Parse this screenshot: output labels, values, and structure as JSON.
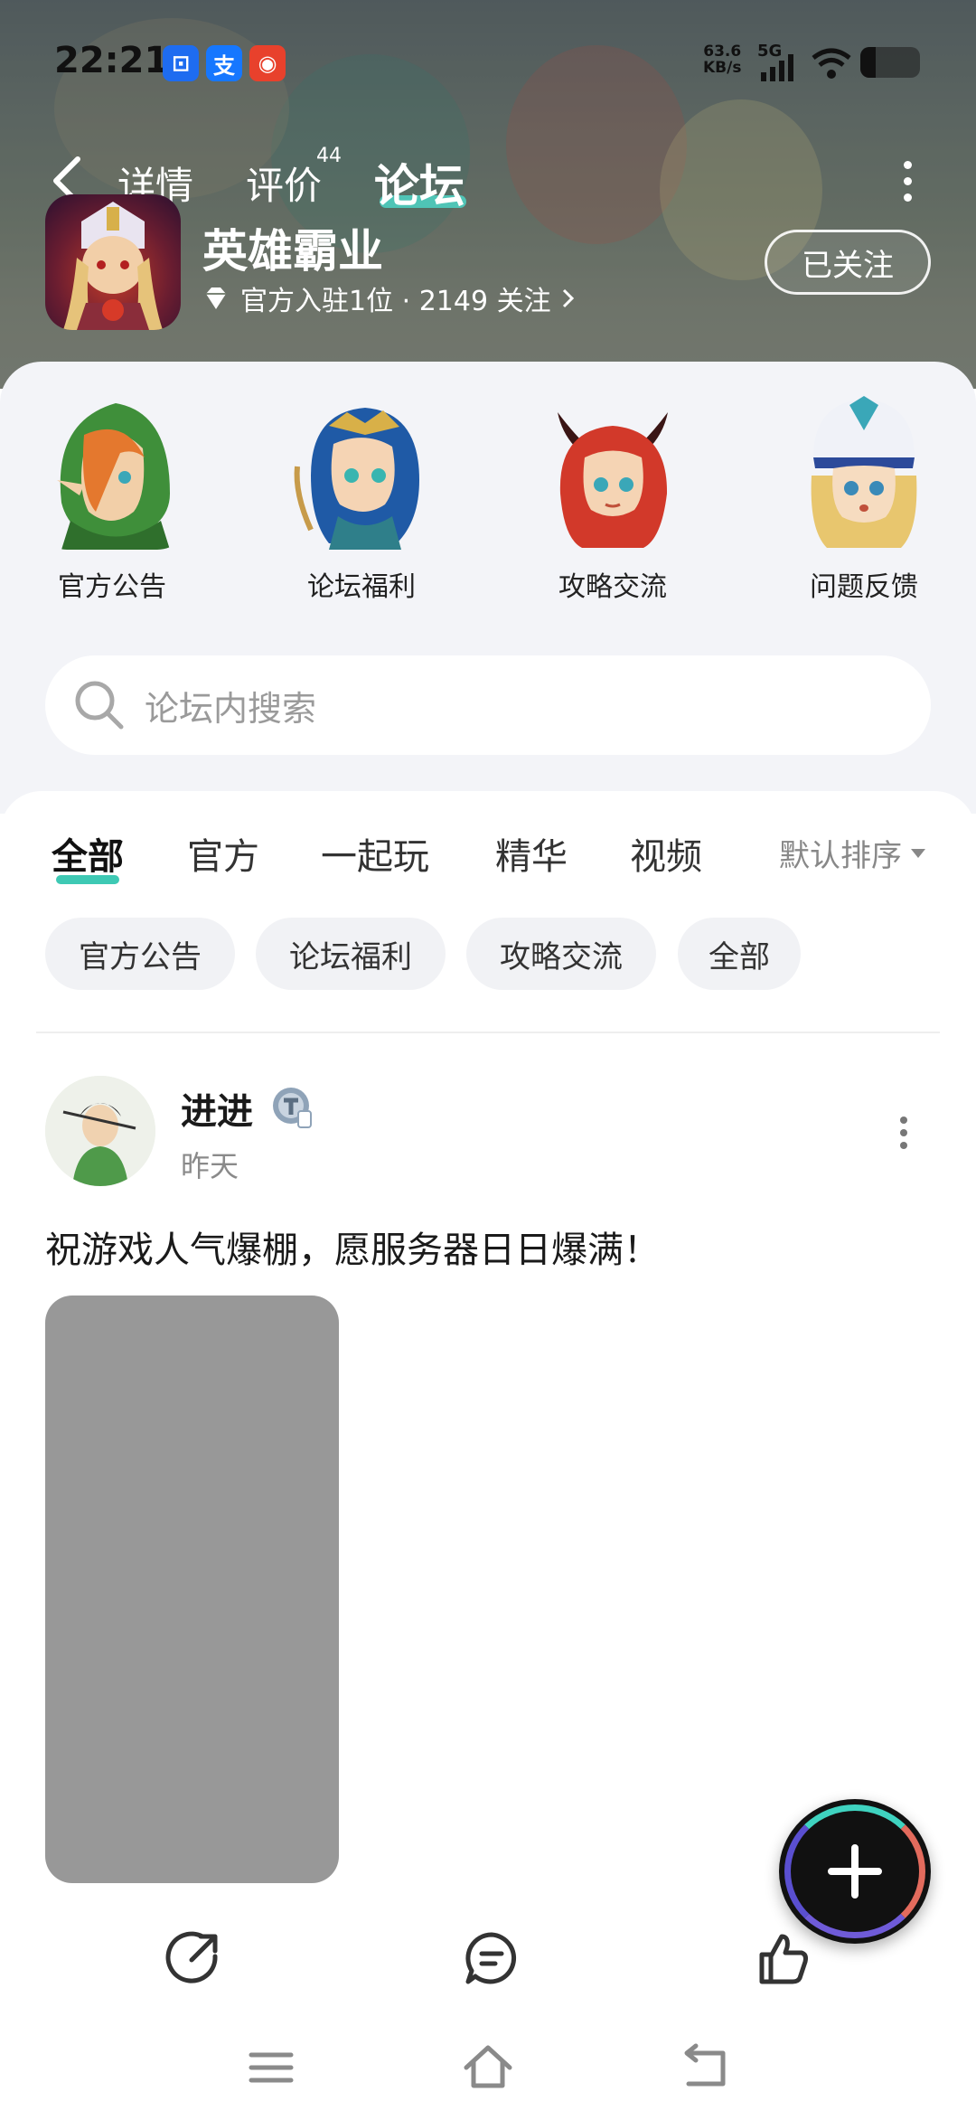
{
  "status_bar": {
    "time": "22:21",
    "apps": [
      {
        "name": "scan-app",
        "glyph": "⊡",
        "color": "#1e6cf0"
      },
      {
        "name": "alipay-app",
        "glyph": "支",
        "color": "#1677ff"
      },
      {
        "name": "red-app",
        "glyph": "◉",
        "color": "#e8412c"
      }
    ],
    "net_speed": "63.6",
    "net_unit": "KB/s",
    "signal": "5G",
    "battery_level": 0.26
  },
  "top_tabs": [
    {
      "label": "详情",
      "active": false
    },
    {
      "label": "评价",
      "active": false,
      "count": "44"
    },
    {
      "label": "论坛",
      "active": true
    }
  ],
  "game": {
    "name": "英雄霸业",
    "meta": "官方入驻1位 · 2149 关注",
    "follow_label": "已关注"
  },
  "categories": [
    {
      "label": "官方公告",
      "icon": "elf-ranger-icon"
    },
    {
      "label": "论坛福利",
      "icon": "elf-archer-icon"
    },
    {
      "label": "攻略交流",
      "icon": "demon-girl-icon"
    },
    {
      "label": "问题反馈",
      "icon": "priestess-icon"
    }
  ],
  "search": {
    "placeholder": "论坛内搜索"
  },
  "feed_tabs": [
    {
      "label": "全部",
      "active": true
    },
    {
      "label": "官方",
      "active": false
    },
    {
      "label": "一起玩",
      "active": false
    },
    {
      "label": "精华",
      "active": false
    },
    {
      "label": "视频",
      "active": false
    }
  ],
  "sort_label": "默认排序",
  "chips": [
    "官方公告",
    "论坛福利",
    "攻略交流",
    "全部"
  ],
  "post": {
    "user": "进进",
    "time": "昨天",
    "text": "祝游戏人气爆棚，愿服务器日日爆满！"
  },
  "colors": {
    "accent": "#3ec9b4",
    "panel_bg": "#f3f4f8",
    "image_placeholder": "#989898"
  }
}
